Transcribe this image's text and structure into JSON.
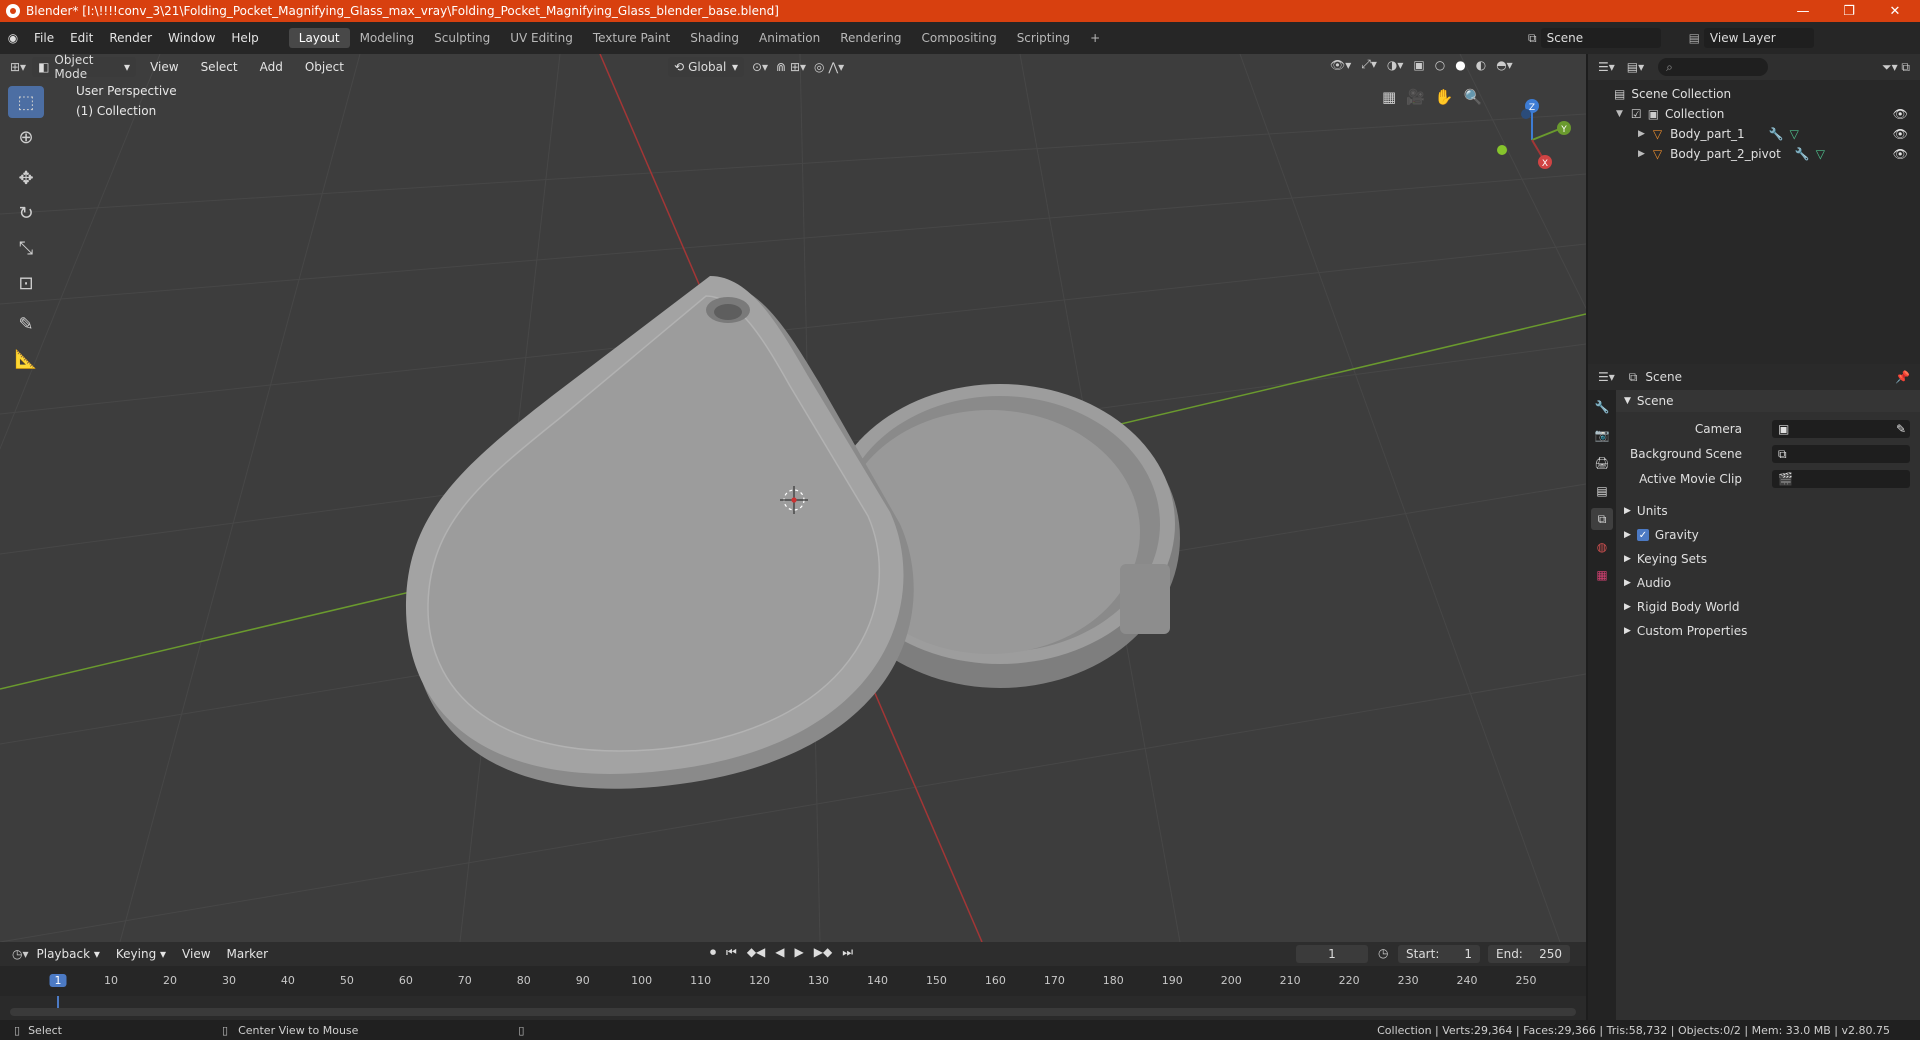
{
  "window": {
    "title": "Blender* [I:\\!!!!conv_3\\21\\Folding_Pocket_Magnifying_Glass_max_vray\\Folding_Pocket_Magnifying_Glass_blender_base.blend]",
    "controls": [
      "—",
      "❐",
      "✕"
    ]
  },
  "menus": [
    "File",
    "Edit",
    "Render",
    "Window",
    "Help"
  ],
  "workspaces": [
    {
      "label": "Layout",
      "active": true
    },
    {
      "label": "Modeling"
    },
    {
      "label": "Sculpting"
    },
    {
      "label": "UV Editing"
    },
    {
      "label": "Texture Paint"
    },
    {
      "label": "Shading"
    },
    {
      "label": "Animation"
    },
    {
      "label": "Rendering"
    },
    {
      "label": "Compositing"
    },
    {
      "label": "Scripting"
    }
  ],
  "scene_selector": "Scene",
  "view_layer_selector": "View Layer",
  "viewport_header": {
    "mode": "Object Mode",
    "menus": [
      "View",
      "Select",
      "Add",
      "Object"
    ],
    "orientation": "Global"
  },
  "viewport": {
    "perspective": "User Perspective",
    "collection": "(1) Collection",
    "axes": {
      "x": "X",
      "y": "Y",
      "z": "Z"
    },
    "colors": {
      "x_axis": "#a33636",
      "y_axis": "#6a9a2e",
      "grid": "#474747",
      "bg": "#3d3d3d"
    }
  },
  "outliner": {
    "root": "Scene Collection",
    "collection": "Collection",
    "objects": [
      "Body_part_1",
      "Body_part_2_pivot"
    ]
  },
  "properties": {
    "header": "Scene",
    "section": "Scene",
    "fields": [
      {
        "label": "Camera"
      },
      {
        "label": "Background Scene"
      },
      {
        "label": "Active Movie Clip"
      }
    ],
    "panels": [
      "Units",
      "Gravity",
      "Keying Sets",
      "Audio",
      "Rigid Body World",
      "Custom Properties"
    ],
    "gravity_checked": true
  },
  "timeline": {
    "menus": [
      "Playback",
      "Keying",
      "View",
      "Marker"
    ],
    "current_frame": "1",
    "start_label": "Start:",
    "start": "1",
    "end_label": "End:",
    "end": "250",
    "ticks": [
      "1",
      "10",
      "20",
      "30",
      "40",
      "50",
      "60",
      "70",
      "80",
      "90",
      "100",
      "110",
      "120",
      "130",
      "140",
      "150",
      "160",
      "170",
      "180",
      "190",
      "200",
      "210",
      "220",
      "230",
      "240",
      "250"
    ]
  },
  "statusbar": {
    "left": "Select",
    "middle": "Center View to Mouse",
    "right": "Collection | Verts:29,364 | Faces:29,366 | Tris:58,732 | Objects:0/2 | Mem: 33.0 MB | v2.80.75"
  }
}
